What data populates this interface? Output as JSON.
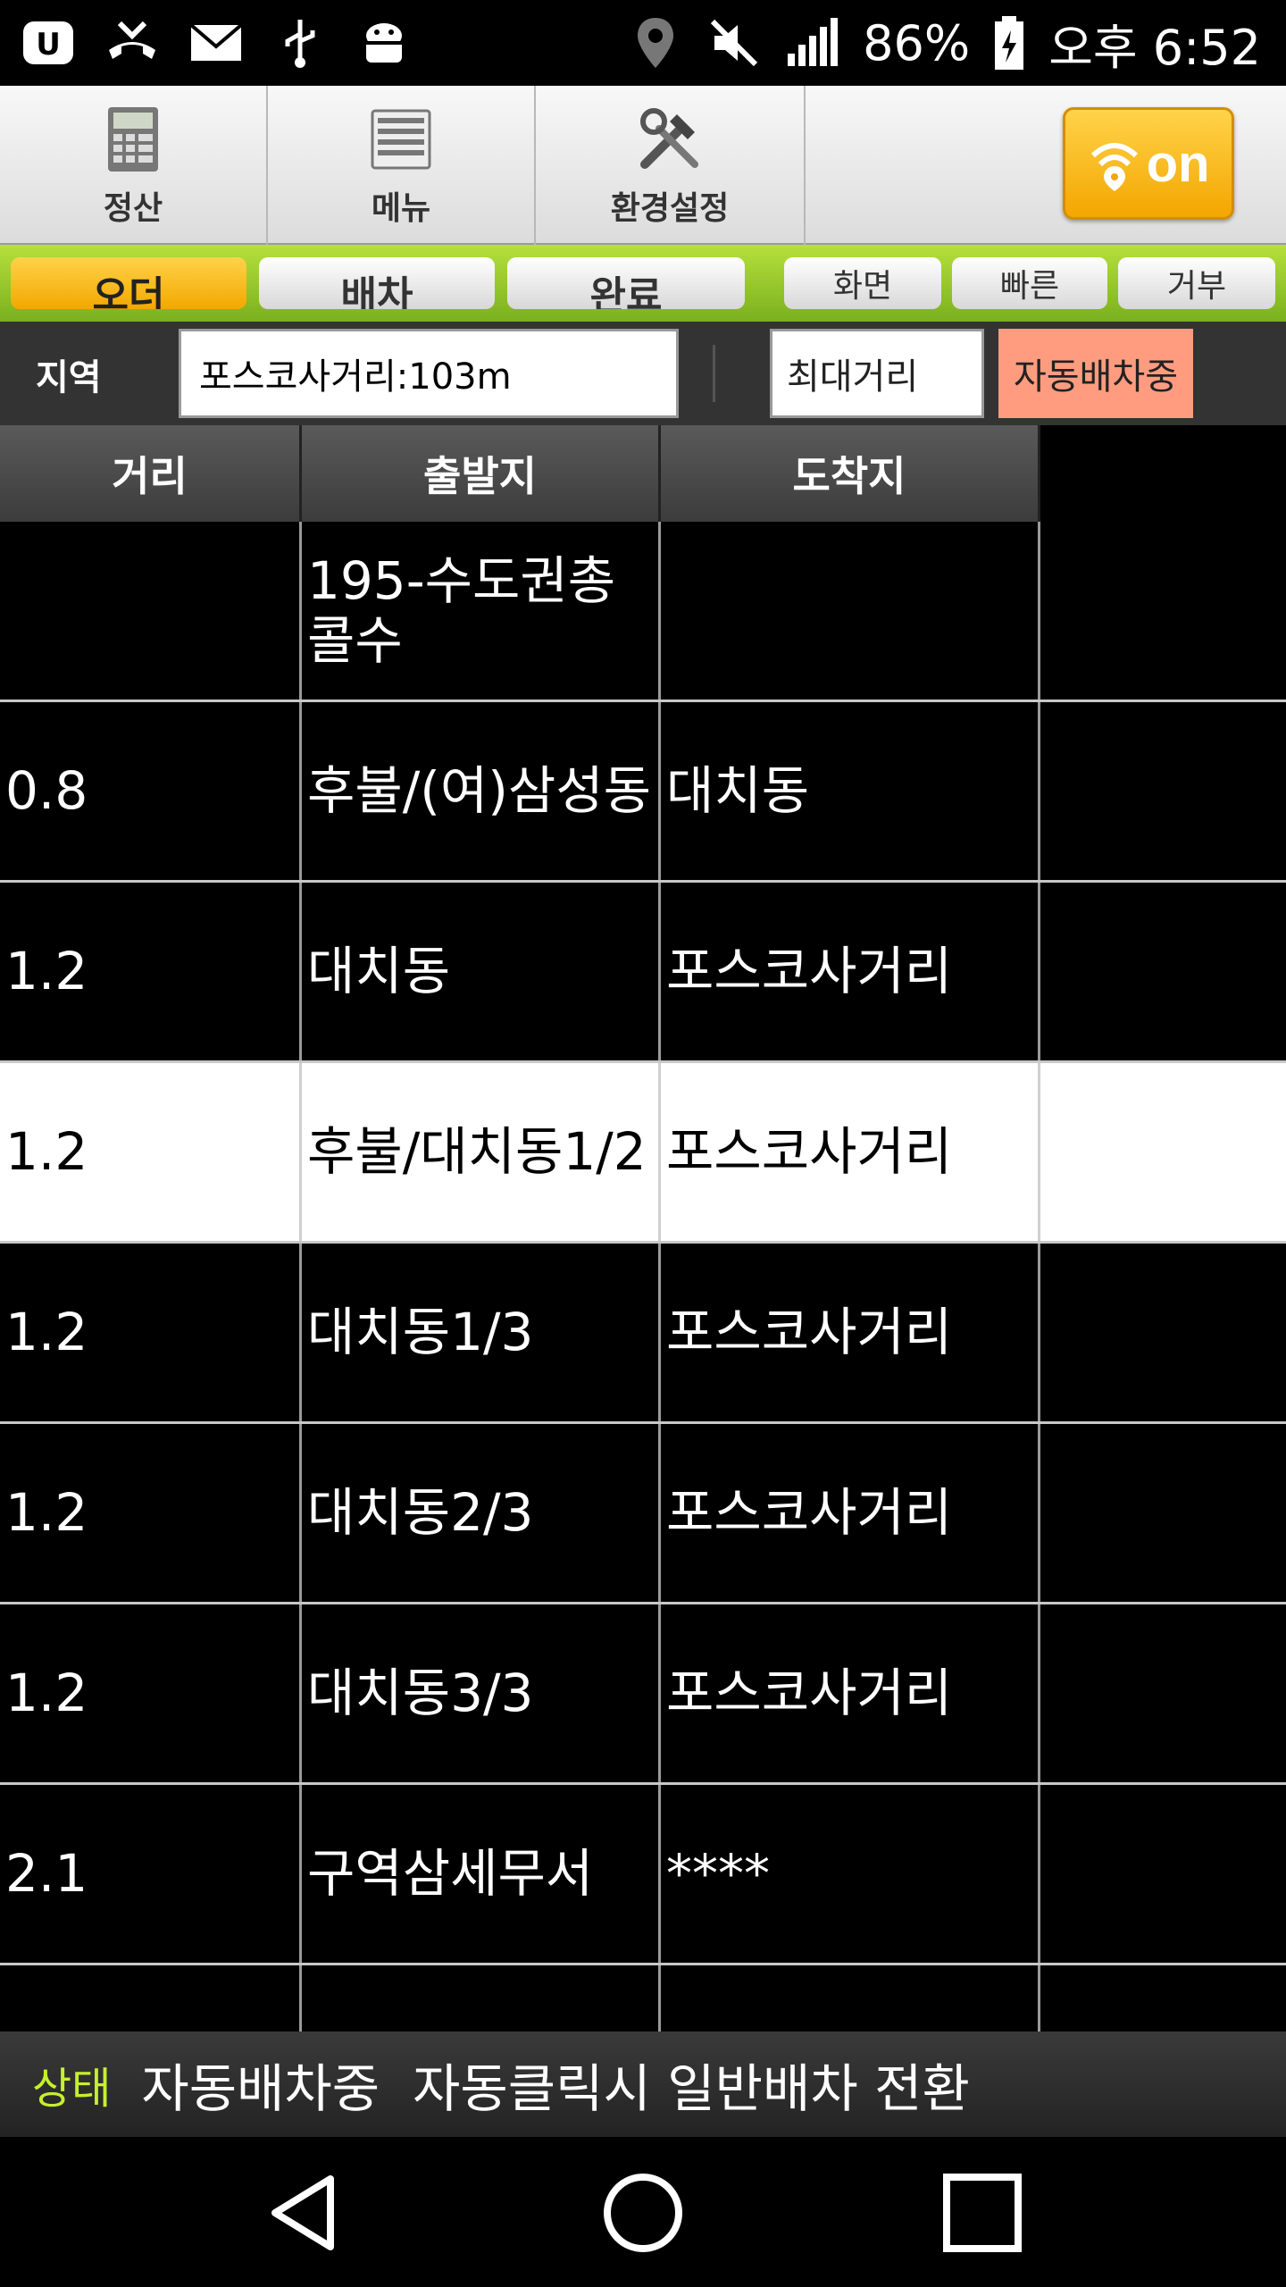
{
  "status_bar": {
    "left_icons": [
      "uplus-icon",
      "missed-call-icon",
      "mail-icon",
      "usb-icon",
      "android-debug-icon"
    ],
    "right_icons": [
      "location-icon",
      "mute-icon",
      "signal-icon",
      "battery-icon"
    ],
    "battery": "86%",
    "time": "오후 6:52"
  },
  "toolbar": {
    "settle_label": "정산",
    "menu_label": "메뉴",
    "settings_label": "환경설정",
    "on_label": "on"
  },
  "tabs": {
    "order": "오더",
    "dispatch": "배차",
    "done": "완료",
    "screen": "화면",
    "fast": "빠른",
    "reject": "거부"
  },
  "filter": {
    "region_label": "지역",
    "region_value": "포스코사거리:103m",
    "max_distance": "최대거리",
    "auto_dispatch": "자동배차중"
  },
  "table": {
    "headers": [
      "거리",
      "출발지",
      "도착지"
    ],
    "rows": [
      {
        "distance": "",
        "origin": "195-수도권총콜수",
        "destination": ""
      },
      {
        "distance": "0.8",
        "origin": "후불/(여)삼성동",
        "destination": "대치동"
      },
      {
        "distance": "1.2",
        "origin": "대치동",
        "destination": "포스코사거리"
      },
      {
        "distance": "1.2",
        "origin": "후불/대치동1/2",
        "destination": "포스코사거리",
        "selected": true
      },
      {
        "distance": "1.2",
        "origin": "대치동1/3",
        "destination": "포스코사거리"
      },
      {
        "distance": "1.2",
        "origin": "대치동2/3",
        "destination": "포스코사거리"
      },
      {
        "distance": "1.2",
        "origin": "대치동3/3",
        "destination": "포스코사거리"
      },
      {
        "distance": "2.1",
        "origin": "구역삼세무서",
        "destination": "****"
      }
    ]
  },
  "status_line": {
    "key": "상태",
    "value": "자동배차중  자동클릭시 일반배차 전환"
  },
  "colors": {
    "accent_green": "#9ccc2c",
    "accent_yellow": "#f6b400",
    "auto_dispatch_bg": "#ff9c80",
    "status_key": "#c6f02c"
  }
}
